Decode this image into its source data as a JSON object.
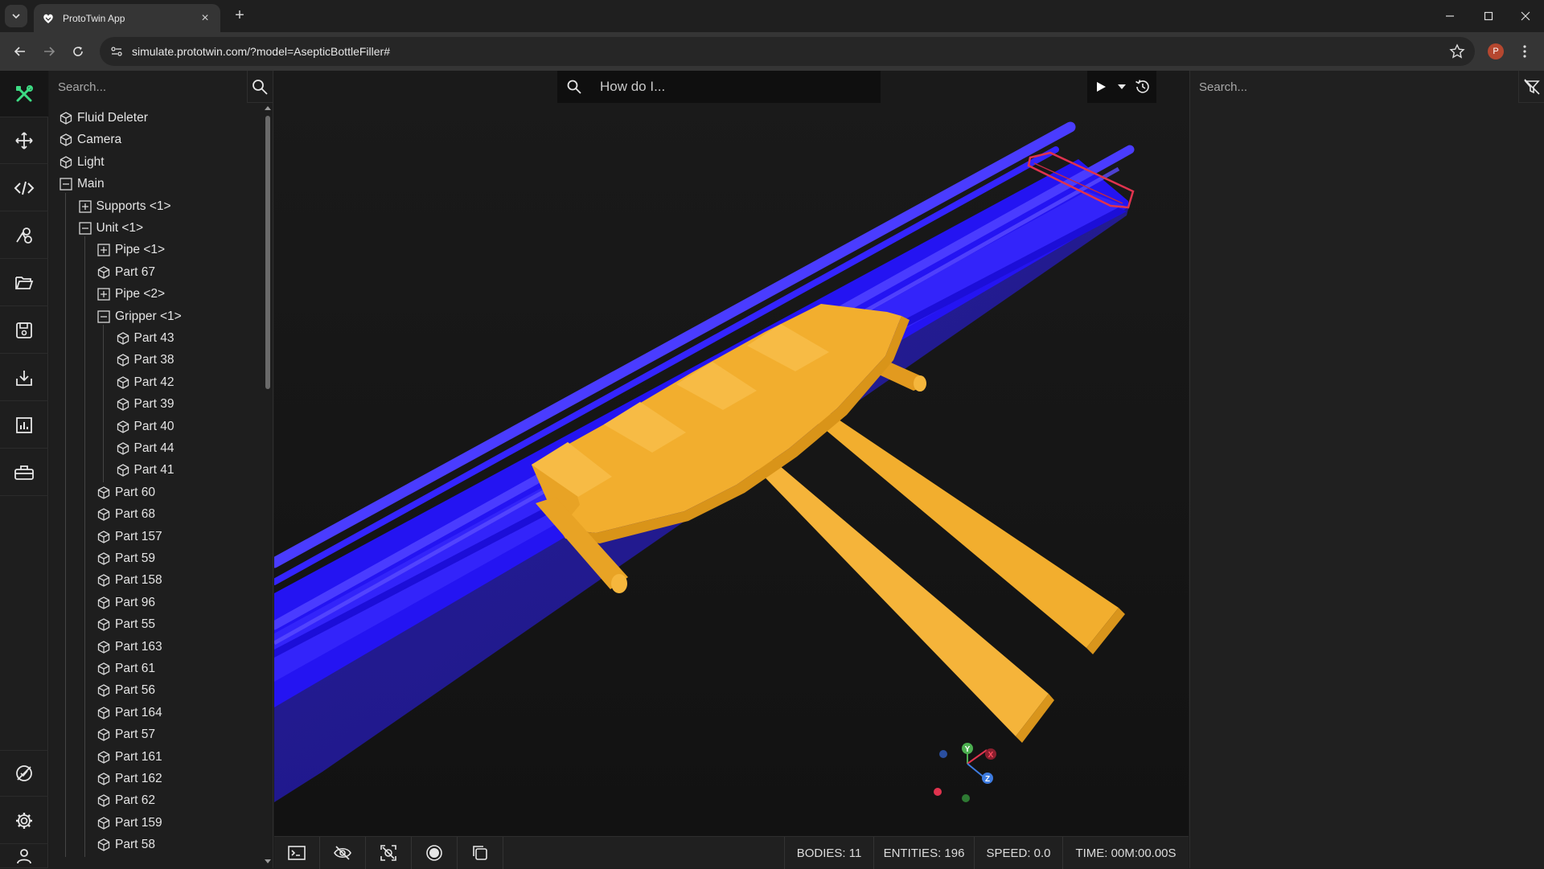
{
  "browser": {
    "tab_title": "ProtoTwin App",
    "url": "simulate.prototwin.com/?model=AsepticBottleFiller#",
    "profile_initial": "P"
  },
  "hierarchy": {
    "search_placeholder": "Search...",
    "items": [
      {
        "label": "Fluid Deleter",
        "kind": "entity",
        "depth": 0
      },
      {
        "label": "Camera",
        "kind": "entity",
        "depth": 0
      },
      {
        "label": "Light",
        "kind": "entity",
        "depth": 0
      },
      {
        "label": "Main",
        "kind": "expanded",
        "depth": 0
      },
      {
        "label": "Supports <1>",
        "kind": "collapsed",
        "depth": 1
      },
      {
        "label": "Unit <1>",
        "kind": "expanded",
        "depth": 1
      },
      {
        "label": "Pipe <1>",
        "kind": "collapsed",
        "depth": 2
      },
      {
        "label": "Part 67",
        "kind": "entity",
        "depth": 2
      },
      {
        "label": "Pipe <2>",
        "kind": "collapsed",
        "depth": 2
      },
      {
        "label": "Gripper <1>",
        "kind": "expanded",
        "depth": 2
      },
      {
        "label": "Part 43",
        "kind": "entity",
        "depth": 3
      },
      {
        "label": "Part 38",
        "kind": "entity",
        "depth": 3
      },
      {
        "label": "Part 42",
        "kind": "entity",
        "depth": 3
      },
      {
        "label": "Part 39",
        "kind": "entity",
        "depth": 3
      },
      {
        "label": "Part 40",
        "kind": "entity",
        "depth": 3
      },
      {
        "label": "Part 44",
        "kind": "entity",
        "depth": 3
      },
      {
        "label": "Part 41",
        "kind": "entity",
        "depth": 3
      },
      {
        "label": "Part 60",
        "kind": "entity",
        "depth": 2
      },
      {
        "label": "Part 68",
        "kind": "entity",
        "depth": 2
      },
      {
        "label": "Part 157",
        "kind": "entity",
        "depth": 2
      },
      {
        "label": "Part 59",
        "kind": "entity",
        "depth": 2
      },
      {
        "label": "Part 158",
        "kind": "entity",
        "depth": 2
      },
      {
        "label": "Part 96",
        "kind": "entity",
        "depth": 2
      },
      {
        "label": "Part 55",
        "kind": "entity",
        "depth": 2
      },
      {
        "label": "Part 163",
        "kind": "entity",
        "depth": 2
      },
      {
        "label": "Part 61",
        "kind": "entity",
        "depth": 2
      },
      {
        "label": "Part 56",
        "kind": "entity",
        "depth": 2
      },
      {
        "label": "Part 164",
        "kind": "entity",
        "depth": 2
      },
      {
        "label": "Part 57",
        "kind": "entity",
        "depth": 2
      },
      {
        "label": "Part 161",
        "kind": "entity",
        "depth": 2
      },
      {
        "label": "Part 162",
        "kind": "entity",
        "depth": 2
      },
      {
        "label": "Part 62",
        "kind": "entity",
        "depth": 2
      },
      {
        "label": "Part 159",
        "kind": "entity",
        "depth": 2
      },
      {
        "label": "Part 58",
        "kind": "entity",
        "depth": 2
      }
    ]
  },
  "viewport": {
    "search_placeholder": "How do I...",
    "gizmo": {
      "y": "Y",
      "x": "X",
      "z": "Z"
    }
  },
  "status": {
    "bodies": "BODIES: 11",
    "entities": "ENTITIES: 196",
    "speed": "SPEED: 0.0",
    "time": "TIME: 00M:00.00S"
  },
  "properties": {
    "search_placeholder": "Search..."
  },
  "colors": {
    "accent": "#3ddc84",
    "conveyor": "#2a18f0",
    "gripper": "#f2ae2e",
    "selection": "#e0334e"
  }
}
